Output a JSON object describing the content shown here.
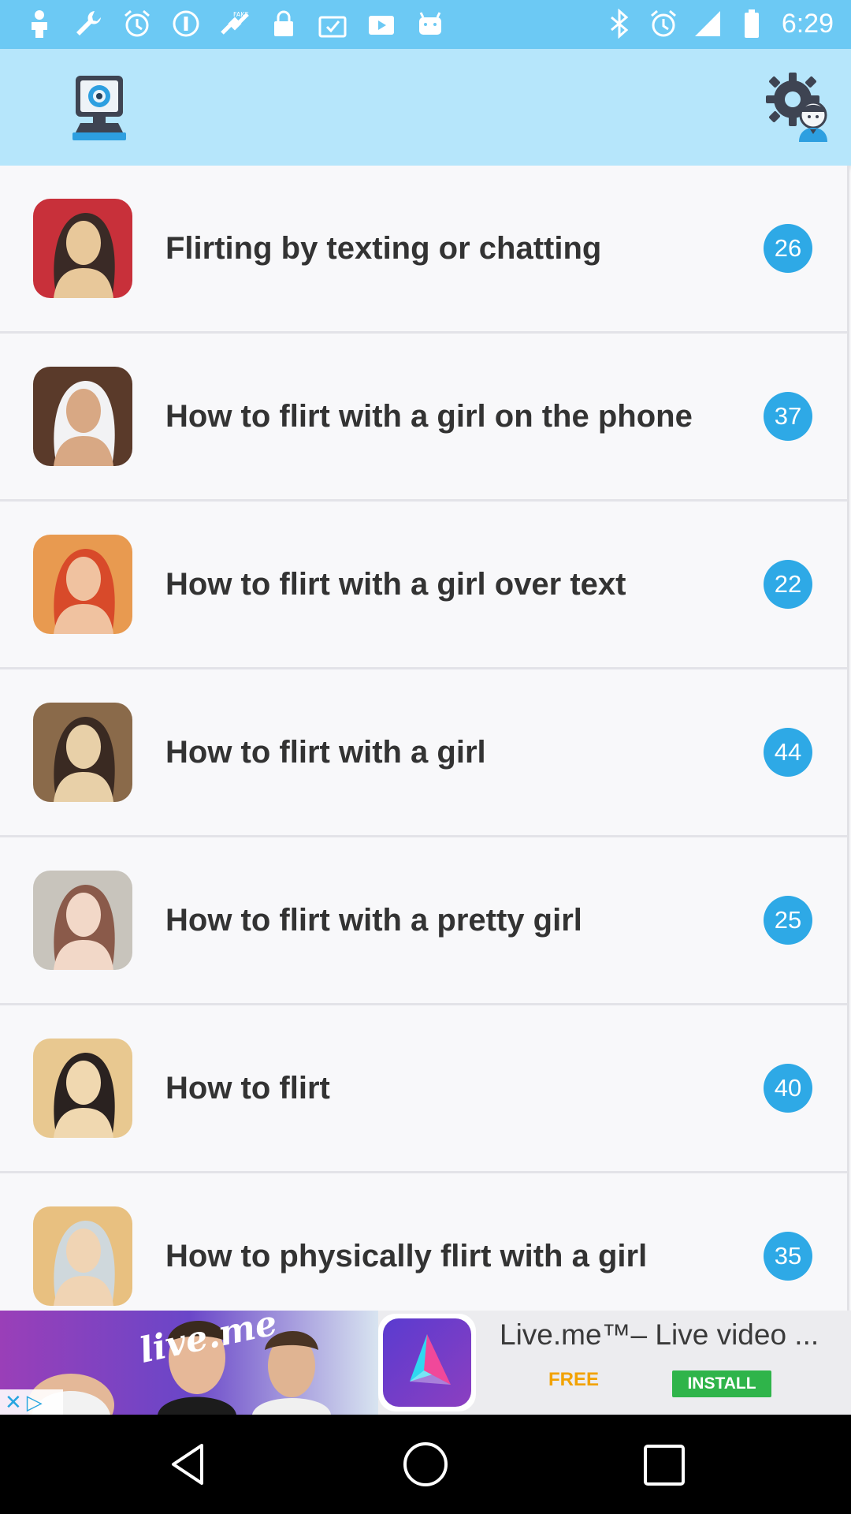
{
  "status_bar": {
    "time": "6:29",
    "left_icons": [
      "person-icon",
      "wrench-icon",
      "alarm-icon",
      "info-icon",
      "satellite-icon",
      "lock-icon",
      "checklist-icon",
      "video-icon",
      "android-icon"
    ],
    "right_icons": [
      "bluetooth-icon",
      "alarm-icon"
    ]
  },
  "app_bar": {
    "left_icon": "webcam-icon",
    "right_icon": "settings-person-icon"
  },
  "list": {
    "items": [
      {
        "title": "Flirting by texting or chatting",
        "count": "26",
        "thumb_colors": [
          "#3a2a26",
          "#e8c89a",
          "#c8303a"
        ]
      },
      {
        "title": "How to flirt with a girl on the phone",
        "count": "37",
        "thumb_colors": [
          "#f2f2f4",
          "#d8a884",
          "#5a3a2a"
        ]
      },
      {
        "title": "How to flirt with a girl over text",
        "count": "22",
        "thumb_colors": [
          "#d84a2a",
          "#f0c2a0",
          "#e89a50"
        ]
      },
      {
        "title": "How to flirt with a girl",
        "count": "44",
        "thumb_colors": [
          "#3a2a22",
          "#e8d0a8",
          "#8a6a4a"
        ]
      },
      {
        "title": "How to flirt with a pretty girl",
        "count": "25",
        "thumb_colors": [
          "#8a5a4a",
          "#f2d8c8",
          "#c8c4bc"
        ]
      },
      {
        "title": "How to flirt",
        "count": "40",
        "thumb_colors": [
          "#2a2220",
          "#f0d8b0",
          "#e8c890"
        ]
      },
      {
        "title": "How to physically flirt with a girl",
        "count": "35",
        "thumb_colors": [
          "#cfd8dc",
          "#f0d4b4",
          "#e8c080"
        ]
      }
    ]
  },
  "ad": {
    "brand": "live.me",
    "title": "Live.me™– Live video ...",
    "price": "FREE",
    "install_label": "INSTALL",
    "close_glyph": "✕",
    "adchoices_glyph": "▷"
  },
  "colors": {
    "status_bar": "#6cc9f4",
    "app_bar": "#b6e6fb",
    "badge": "#2ea9e6",
    "install": "#2fb44a",
    "free": "#f2a200"
  }
}
